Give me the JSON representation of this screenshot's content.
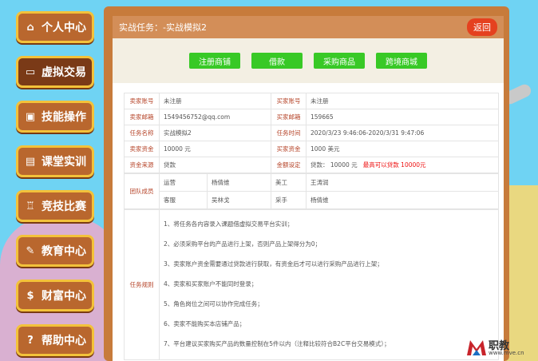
{
  "sidebar": {
    "items": [
      {
        "label": "个人中心",
        "icon": "home-icon",
        "active": false
      },
      {
        "label": "虚拟交易",
        "icon": "computer-icon",
        "active": true
      },
      {
        "label": "技能操作",
        "icon": "briefcase-icon",
        "active": false
      },
      {
        "label": "课堂实训",
        "icon": "book-icon",
        "active": false
      },
      {
        "label": "竞技比赛",
        "icon": "trophy-icon",
        "active": false
      },
      {
        "label": "教育中心",
        "icon": "pencil-icon",
        "active": false
      },
      {
        "label": "财富中心",
        "icon": "money-bag-icon",
        "active": false
      },
      {
        "label": "帮助中心",
        "icon": "question-icon",
        "active": false
      }
    ]
  },
  "header": {
    "title": "实战任务：-实战模拟2",
    "back_label": "返回"
  },
  "actions": [
    "注册商铺",
    "借款",
    "采购商品",
    "跨境商城"
  ],
  "info": {
    "seller_account_label": "卖家账号",
    "seller_account": "未注册",
    "buyer_account_label": "买家账号",
    "buyer_account": "未注册",
    "seller_email_label": "卖家邮箱",
    "seller_email": "1549456752@qq.com",
    "buyer_email_label": "买家邮箱",
    "buyer_email": "159665",
    "task_name_label": "任务名称",
    "task_name": "实战模拟2",
    "task_time_label": "任务时间",
    "task_time": "2020/3/23 9:46:06-2020/3/31 9:47:06",
    "seller_fund_label": "卖家资金",
    "seller_fund": "10000 元",
    "buyer_fund_label": "买家资金",
    "buyer_fund": "1000 美元",
    "fund_source_label": "资金来源",
    "fund_source": "贷款",
    "fund_setting_label": "金额设定",
    "fund_setting_prefix": "贷款：",
    "fund_setting_value": "10000 元",
    "fund_setting_max": "最高可以贷款 10000元"
  },
  "team": {
    "label": "团队成员",
    "rows": [
      [
        "运营",
        "杨倩维",
        "美工",
        "王涛润"
      ],
      [
        "客服",
        "吴林戈",
        "采手",
        "杨倩维"
      ]
    ]
  },
  "rules": {
    "label": "任务规则",
    "items": [
      "1、将任务各内容录入课题借虚拟交易平台实训；",
      "2、必须采购平台的产品进行上架，否则产品上架得分为0；",
      "3、卖家账户资金需要通过贷款进行获取，有资金后才可以进行采购产品进行上架；",
      "4、卖家和买家账户不能同时登录；",
      "5、角色岗位之间可以协作完成任务；",
      "6、卖家不能购买本店铺产品；",
      "7、平台建议买家购买产品的数量控制在5件以内（注释比较符合B2C平台交易模式）；"
    ]
  },
  "watermark": {
    "text": "职教",
    "url": "www.mve.cn"
  }
}
